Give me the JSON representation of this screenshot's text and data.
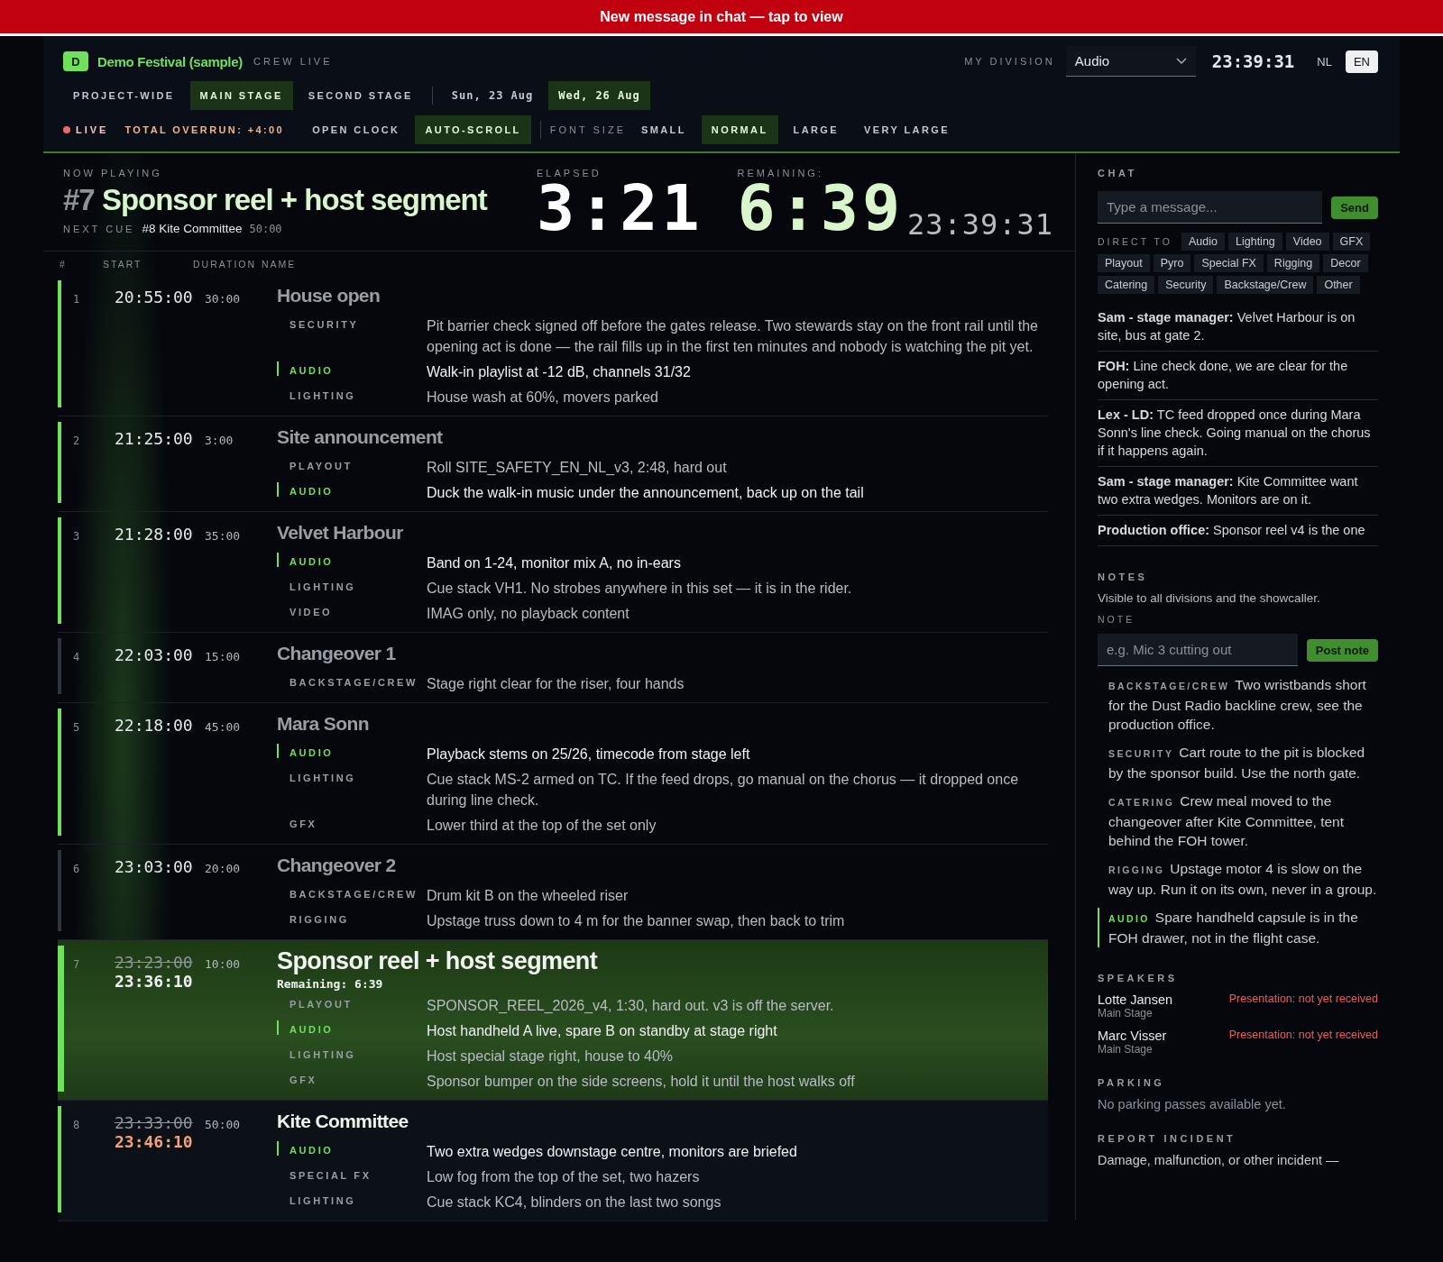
{
  "banner": {
    "text": "New message in chat — tap to view"
  },
  "header": {
    "logo_badge": "D",
    "event_title": "Demo Festival (sample)",
    "mode_label": "CREW LIVE",
    "division_label": "MY DIVISION",
    "division_select": "Audio",
    "clock": "23:39:31",
    "languages": [
      {
        "label": "NL",
        "selected": false
      },
      {
        "label": "EN",
        "selected": true
      }
    ]
  },
  "stage_tabs": [
    {
      "label": "PROJECT-WIDE",
      "selected": false
    },
    {
      "label": "MAIN STAGE",
      "selected": true
    },
    {
      "label": "SECOND STAGE",
      "selected": false
    }
  ],
  "date_tabs": [
    {
      "label": "Sun, 23 Aug",
      "selected": false
    },
    {
      "label": "Wed, 26 Aug",
      "selected": true
    }
  ],
  "toolbar": {
    "live_label": "LIVE",
    "overrun": "TOTAL OVERRUN: +4:00",
    "toggles": [
      {
        "label": "OPEN CLOCK",
        "selected": false
      },
      {
        "label": "AUTO-SCROLL",
        "selected": true
      }
    ],
    "font_size_label": "FONT SIZE",
    "font_sizes": [
      {
        "label": "SMALL",
        "selected": false
      },
      {
        "label": "NORMAL",
        "selected": true
      },
      {
        "label": "LARGE",
        "selected": false
      },
      {
        "label": "VERY LARGE",
        "selected": false
      }
    ]
  },
  "now_playing": {
    "label": "NOW PLAYING",
    "number": "#7",
    "title": "Sponsor reel + host segment",
    "next_label": "NEXT CUE",
    "next_title": "#8 Kite Committee",
    "next_duration": "50:00",
    "elapsed_label": "ELAPSED",
    "elapsed": "3:21",
    "remaining_label": "REMAINING:",
    "remaining": "6:39",
    "clock": "23:39:31"
  },
  "table": {
    "columns": [
      "#",
      "START",
      "DURATION",
      "NAME"
    ],
    "rows": [
      {
        "number": "1",
        "start": "20:55:00",
        "duration": "30:00",
        "name": "House open",
        "kind": "past",
        "color": "#6ee05a",
        "notes": [
          {
            "division": "SECURITY",
            "text": "Pit barrier check signed off before the gates release. Two stewards stay on the front rail until the opening act is done — the rail fills up in the first ten minutes and nobody is watching the pit yet.",
            "mine": false
          },
          {
            "division": "AUDIO",
            "text": "Walk-in playlist at -12 dB, channels 31/32",
            "mine": true
          },
          {
            "division": "LIGHTING",
            "text": "House wash at 60%, movers parked",
            "mine": false
          }
        ]
      },
      {
        "number": "2",
        "start": "21:25:00",
        "duration": "3:00",
        "name": "Site announcement",
        "kind": "past",
        "color": "#6ee05a",
        "notes": [
          {
            "division": "PLAYOUT",
            "text": "Roll SITE_SAFETY_EN_NL_v3, 2:48, hard out",
            "mine": false
          },
          {
            "division": "AUDIO",
            "text": "Duck the walk-in music under the announcement, back up on the tail",
            "mine": true
          }
        ]
      },
      {
        "number": "3",
        "start": "21:28:00",
        "duration": "35:00",
        "name": "Velvet Harbour",
        "kind": "past",
        "color": "#6ee05a",
        "notes": [
          {
            "division": "AUDIO",
            "text": "Band on 1-24, monitor mix A, no in-ears",
            "mine": true
          },
          {
            "division": "LIGHTING",
            "text": "Cue stack VH1. No strobes anywhere in this set — it is in the rider.",
            "mine": false
          },
          {
            "division": "VIDEO",
            "text": "IMAG only, no playback content",
            "mine": false
          }
        ]
      },
      {
        "number": "4",
        "start": "22:03:00",
        "duration": "15:00",
        "name": "Changeover 1",
        "kind": "past",
        "color": "#30353d",
        "notes": [
          {
            "division": "BACKSTAGE/CREW",
            "text": "Stage right clear for the riser, four hands",
            "mine": false
          }
        ]
      },
      {
        "number": "5",
        "start": "22:18:00",
        "duration": "45:00",
        "name": "Mara Sonn",
        "kind": "past",
        "color": "#6ee05a",
        "notes": [
          {
            "division": "AUDIO",
            "text": "Playback stems on 25/26, timecode from stage left",
            "mine": true
          },
          {
            "division": "LIGHTING",
            "text": "Cue stack MS-2 armed on TC. If the feed drops, go manual on the chorus — it dropped once during line check.",
            "mine": false
          },
          {
            "division": "GFX",
            "text": "Lower third at the top of the set only",
            "mine": false
          }
        ]
      },
      {
        "number": "6",
        "start": "23:03:00",
        "duration": "20:00",
        "name": "Changeover 2",
        "kind": "past",
        "color": "#30353d",
        "notes": [
          {
            "division": "BACKSTAGE/CREW",
            "text": "Drum kit B on the wheeled riser",
            "mine": false
          },
          {
            "division": "RIGGING",
            "text": "Upstage truss down to 4 m for the banner swap, then back to trim",
            "mine": false
          }
        ]
      },
      {
        "number": "7",
        "start": "23:23:00",
        "adjusted_start": "23:36:10",
        "duration": "10:00",
        "name": "Sponsor reel + host segment",
        "remaining": "Remaining: 6:39",
        "kind": "current",
        "color": "#6ee05a",
        "notes": [
          {
            "division": "PLAYOUT",
            "text": "SPONSOR_REEL_2026_v4, 1:30, hard out. v3 is off the server.",
            "mine": false
          },
          {
            "division": "AUDIO",
            "text": "Host handheld A live, spare B on standby at stage right",
            "mine": true
          },
          {
            "division": "LIGHTING",
            "text": "Host special stage right, house to 40%",
            "mine": false
          },
          {
            "division": "GFX",
            "text": "Sponsor bumper on the side screens, hold it until the host walks off",
            "mine": false
          }
        ]
      },
      {
        "number": "8",
        "start": "23:33:00",
        "adjusted_start": "23:46:10",
        "duration": "50:00",
        "name": "Kite Committee",
        "kind": "next",
        "color": "#6ee05a",
        "notes": [
          {
            "division": "AUDIO",
            "text": "Two extra wedges downstage centre, monitors are briefed",
            "mine": true
          },
          {
            "division": "SPECIAL FX",
            "text": "Low fog from the top of the set, two hazers",
            "mine": false
          },
          {
            "division": "LIGHTING",
            "text": "Cue stack KC4, blinders on the last two songs",
            "mine": false
          }
        ]
      }
    ]
  },
  "chat": {
    "title": "CHAT",
    "placeholder": "Type a message...",
    "send": "Send",
    "direct_label": "DIRECT TO",
    "recipients": [
      "Audio",
      "Lighting",
      "Video",
      "GFX",
      "Playout",
      "Pyro",
      "Special FX",
      "Rigging",
      "Decor",
      "Catering",
      "Security",
      "Backstage/Crew",
      "Other"
    ],
    "messages": [
      {
        "author": "Sam - stage manager:",
        "text": "Velvet Harbour is on site, bus at gate 2."
      },
      {
        "author": "FOH:",
        "text": "Line check done, we are clear for the opening act."
      },
      {
        "author": "Lex - LD:",
        "text": "TC feed dropped once during Mara Sonn's line check. Going manual on the chorus if it happens again."
      },
      {
        "author": "Sam - stage manager:",
        "text": "Kite Committee want two extra wedges. Monitors are on it."
      },
      {
        "author": "Production office:",
        "text": "Sponsor reel v4 is the one"
      }
    ]
  },
  "notes": {
    "title": "NOTES",
    "description": "Visible to all divisions and the showcaller.",
    "field_label": "NOTE",
    "placeholder": "e.g. Mic 3 cutting out",
    "button": "Post note",
    "items": [
      {
        "division": "BACKSTAGE/CREW",
        "text": "Two wristbands short for the Dust Radio backline crew, see the production office.",
        "mine": false
      },
      {
        "division": "SECURITY",
        "text": "Cart route to the pit is blocked by the sponsor build. Use the north gate.",
        "mine": false
      },
      {
        "division": "CATERING",
        "text": "Crew meal moved to the changeover after Kite Committee, tent behind the FOH tower.",
        "mine": false
      },
      {
        "division": "RIGGING",
        "text": "Upstage motor 4 is slow on the way up. Run it on its own, never in a group.",
        "mine": false
      },
      {
        "division": "AUDIO",
        "text": "Spare handheld capsule is in the FOH drawer, not in the flight case.",
        "mine": true
      }
    ]
  },
  "speakers": {
    "title": "SPEAKERS",
    "items": [
      {
        "name": "Lotte Jansen",
        "stage": "Main Stage",
        "status": "Presentation: not yet received"
      },
      {
        "name": "Marc Visser",
        "stage": "Main Stage",
        "status": "Presentation: not yet received"
      }
    ]
  },
  "parking": {
    "title": "PARKING",
    "text": "No parking passes available yet."
  },
  "report": {
    "title": "REPORT INCIDENT",
    "text": "Damage, malfunction, or other incident —"
  }
}
